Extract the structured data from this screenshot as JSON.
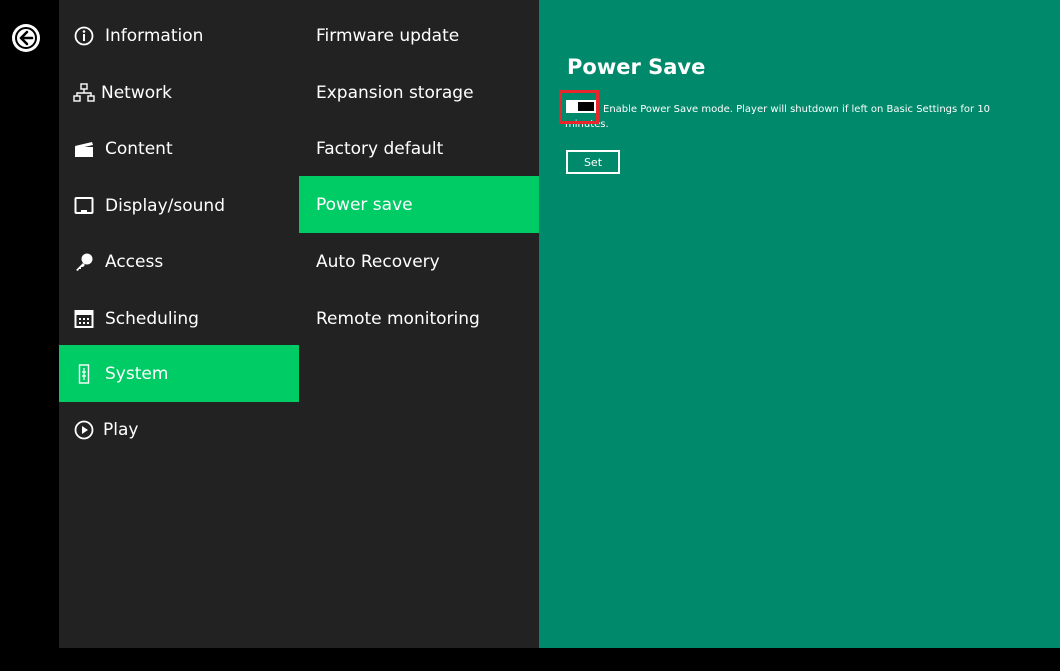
{
  "main_menu": [
    {
      "label": "Information",
      "icon": "info-icon"
    },
    {
      "label": "Network",
      "icon": "network-icon"
    },
    {
      "label": "Content",
      "icon": "clapperboard-icon"
    },
    {
      "label": "Display/sound",
      "icon": "monitor-icon"
    },
    {
      "label": "Access",
      "icon": "key-icon"
    },
    {
      "label": "Scheduling",
      "icon": "calendar-icon"
    },
    {
      "label": "System",
      "icon": "system-icon",
      "active": true
    },
    {
      "label": "Play",
      "icon": "play-icon"
    }
  ],
  "system_menu": [
    {
      "label": "Firmware update"
    },
    {
      "label": "Expansion storage"
    },
    {
      "label": "Factory default"
    },
    {
      "label": "Power save",
      "active": true
    },
    {
      "label": "Auto Recovery"
    },
    {
      "label": "Remote monitoring"
    }
  ],
  "panel": {
    "title": "Power Save",
    "description": "Enable Power Save mode. Player will shutdown if left on Basic Settings for 10 minutes.",
    "set_label": "Set",
    "toggle_on": false
  },
  "colors": {
    "accent": "#00cc66",
    "panel_bg": "#00896a",
    "menu_bg": "#222222",
    "highlight": "#e8262b"
  }
}
